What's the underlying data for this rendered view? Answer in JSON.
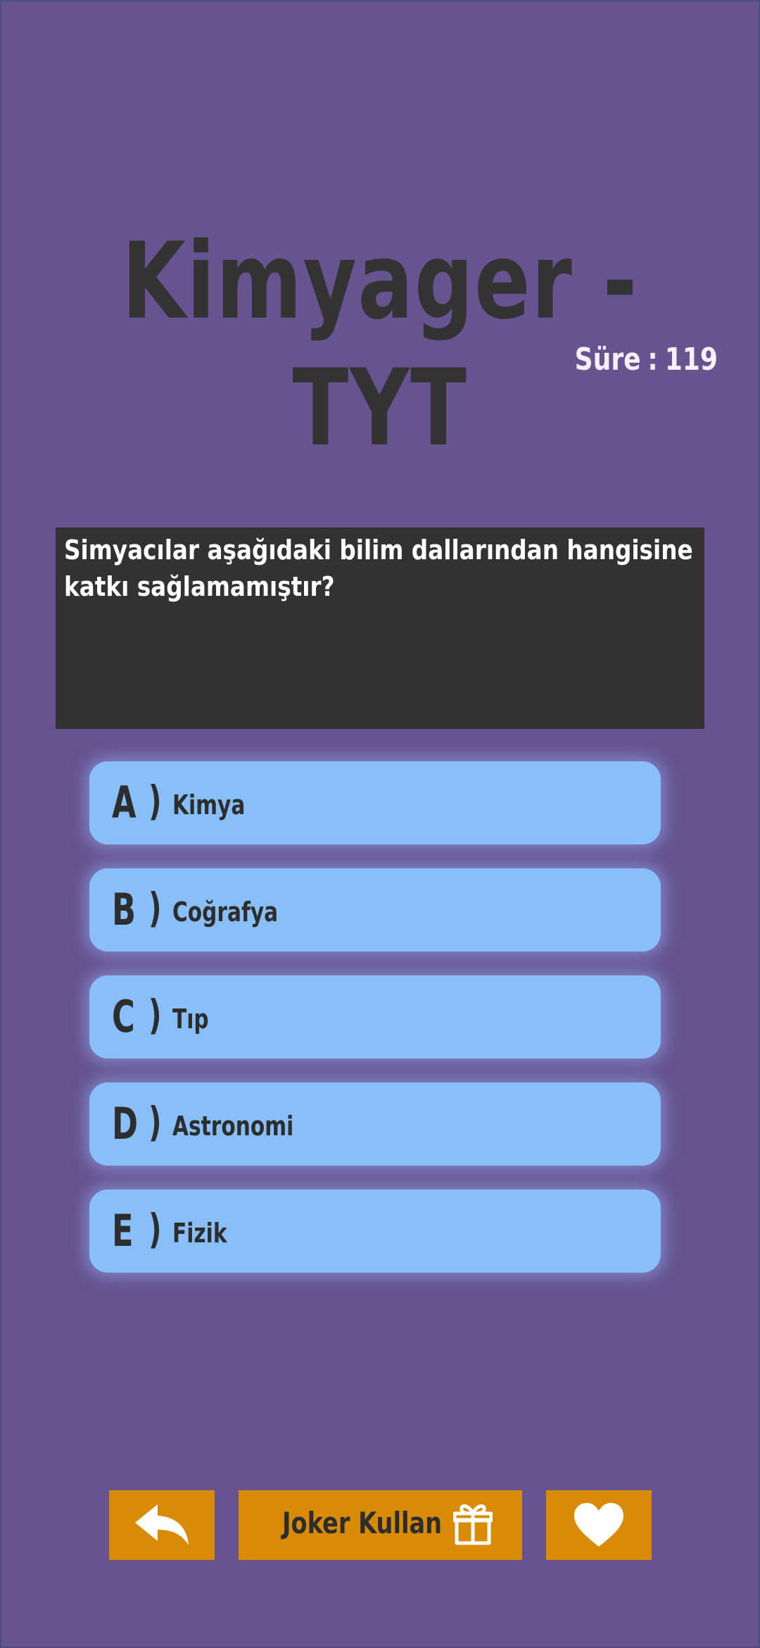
{
  "header": {
    "title": "Kimyager - TYT",
    "timer_label": "Süre",
    "timer_separator": ":",
    "timer_value": "119"
  },
  "question": {
    "text": "Simyacılar aşağıdaki bilim dallarından hangisine katkı sağlamamıştır?"
  },
  "options": [
    {
      "letter": "A",
      "paren": ")",
      "text": "Kimya"
    },
    {
      "letter": "B",
      "paren": ")",
      "text": "Coğrafya"
    },
    {
      "letter": "C",
      "paren": ")",
      "text": "Tıp"
    },
    {
      "letter": "D",
      "paren": ")",
      "text": "Astronomi"
    },
    {
      "letter": "E",
      "paren": ")",
      "text": "Fizik"
    }
  ],
  "toolbar": {
    "back_icon": "back-arrow-icon",
    "joker_label": "Joker Kullan",
    "joker_icon": "gift-icon",
    "heart_icon": "heart-icon"
  },
  "colors": {
    "background": "#66538f",
    "title": "#333333",
    "question_box": "#323232",
    "option_fill": "#89bff8",
    "button_fill": "#d98b06"
  }
}
